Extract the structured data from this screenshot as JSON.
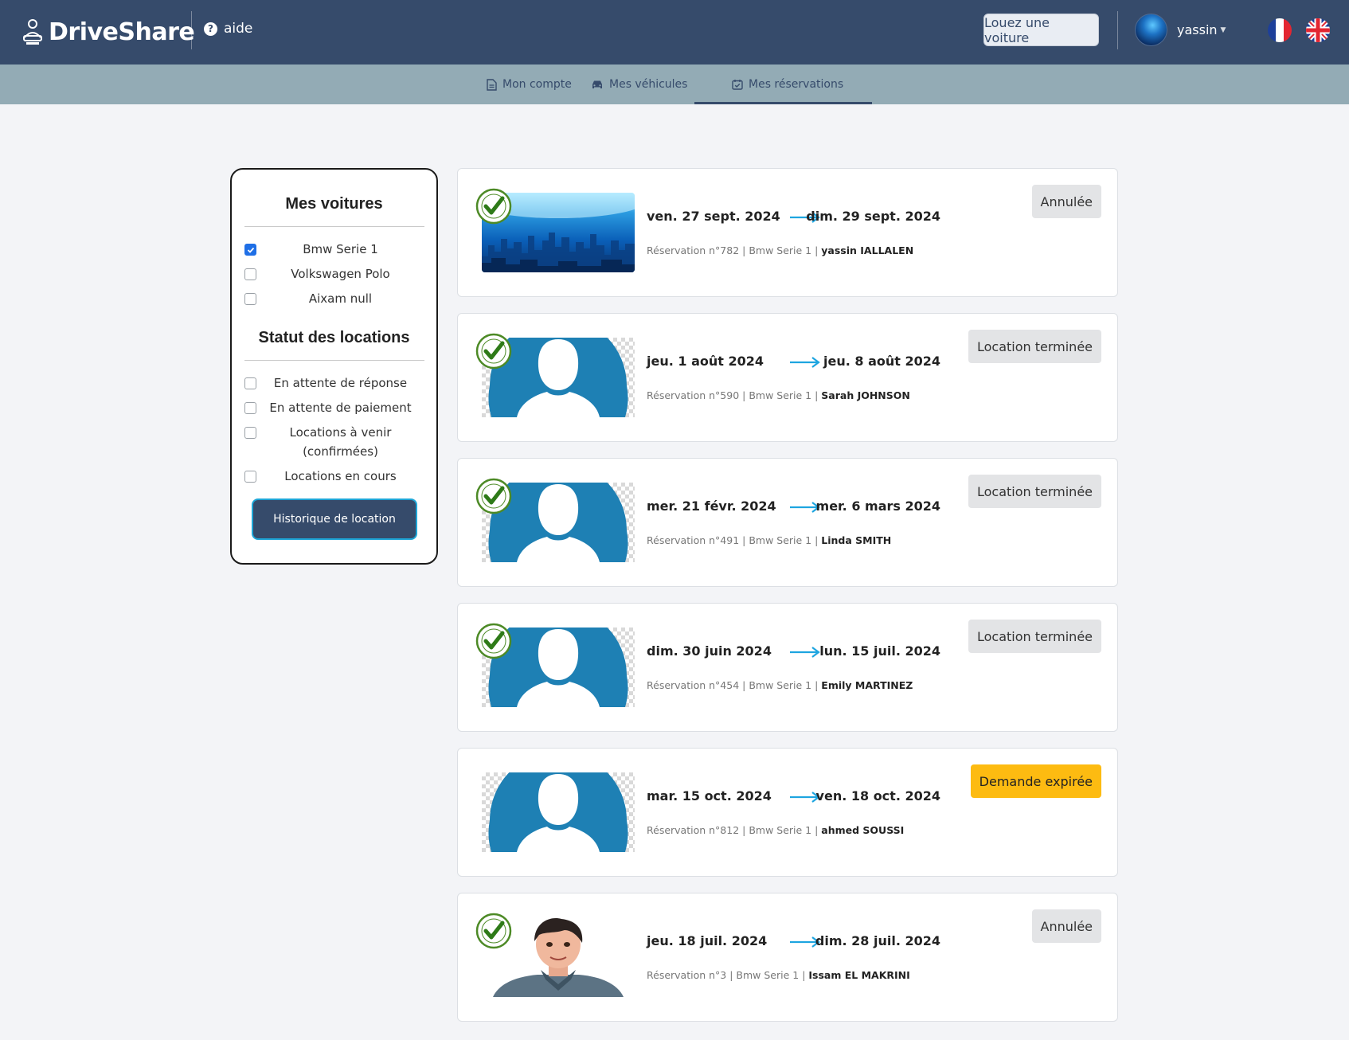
{
  "header": {
    "brand": "DriveShare",
    "help_label": "aide",
    "rent_button": "Louez une voiture",
    "username": "yassin"
  },
  "nav": {
    "tabs": [
      {
        "label": "Mon compte",
        "icon": "document-icon"
      },
      {
        "label": "Mes véhicules",
        "icon": "car-icon"
      },
      {
        "label": "Mes réservations",
        "icon": "calendar-check-icon",
        "active": true
      }
    ]
  },
  "filters": {
    "cars_title": "Mes voitures",
    "cars": [
      {
        "label": "Bmw Serie 1",
        "checked": true
      },
      {
        "label": "Volkswagen Polo",
        "checked": false
      },
      {
        "label": "Aixam null",
        "checked": false
      }
    ],
    "status_title": "Statut des locations",
    "statuses": [
      {
        "label": "En attente de réponse",
        "checked": false
      },
      {
        "label": "En attente de paiement",
        "checked": false
      },
      {
        "label": "Locations à venir (confirmées)",
        "checked": false
      },
      {
        "label": "Locations en cours",
        "checked": false
      }
    ],
    "history_button": "Historique de location"
  },
  "reservations": [
    {
      "from": "ven. 27 sept. 2024",
      "to": "dim. 29 sept. 2024",
      "meta": "Réservation n°782 | Bmw Serie 1 | ",
      "renter": "yassin IALLALEN",
      "status": "Annulée",
      "verified": true,
      "image": "city"
    },
    {
      "from": "jeu. 1 août 2024",
      "to": "jeu. 8 août 2024",
      "meta": "Réservation n°590 | Bmw Serie 1 | ",
      "renter": "Sarah JOHNSON",
      "status": "Location terminée",
      "verified": true,
      "image": "silhouette"
    },
    {
      "from": "mer. 21 févr. 2024",
      "to": "mer. 6 mars 2024",
      "meta": "Réservation n°491 | Bmw Serie 1 | ",
      "renter": "Linda SMITH",
      "status": "Location terminée",
      "verified": true,
      "image": "silhouette"
    },
    {
      "from": "dim. 30 juin 2024",
      "to": "lun. 15 juil. 2024",
      "meta": "Réservation n°454 | Bmw Serie 1 | ",
      "renter": "Emily MARTINEZ",
      "status": "Location terminée",
      "verified": true,
      "image": "silhouette"
    },
    {
      "from": "mar. 15 oct. 2024",
      "to": "ven. 18 oct. 2024",
      "meta": "Réservation n°812 | Bmw Serie 1 | ",
      "renter": "ahmed SOUSSI",
      "status": "Demande expirée",
      "verified": false,
      "image": "silhouette"
    },
    {
      "from": "jeu. 18 juil. 2024",
      "to": "dim. 28 juil. 2024",
      "meta": "Réservation n°3 | Bmw Serie 1 | ",
      "renter": "Issam EL MAKRINI",
      "status": "Annulée",
      "verified": true,
      "image": "cartoon"
    }
  ],
  "colors": {
    "header_bg": "#364b6b",
    "subnav_bg": "#93abb5",
    "accent_arrow": "#1ea5e0",
    "expired_status": "#fdbb11",
    "neutral_status": "#e3e4e6"
  }
}
